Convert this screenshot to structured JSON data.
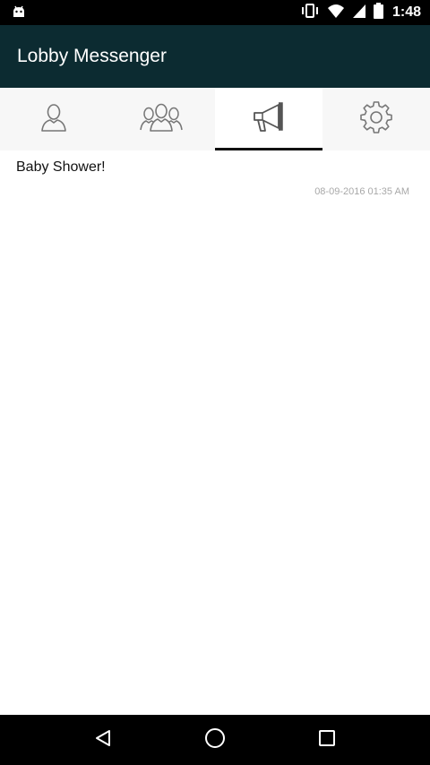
{
  "status_bar": {
    "time": "1:48",
    "icons": [
      "android-debug-icon",
      "vibrate-icon",
      "wifi-icon",
      "signal-icon",
      "battery-icon"
    ]
  },
  "app_bar": {
    "title": "Lobby Messenger",
    "background": "#0c2b31"
  },
  "tabs": [
    {
      "icon": "person-icon",
      "active": false
    },
    {
      "icon": "group-icon",
      "active": false
    },
    {
      "icon": "megaphone-icon",
      "active": true
    },
    {
      "icon": "gear-icon",
      "active": false
    }
  ],
  "announcements": [
    {
      "title": "Baby Shower!",
      "timestamp": "08-09-2016 01:35 AM"
    }
  ],
  "nav_bar": {
    "buttons": [
      "back-icon",
      "home-icon",
      "recents-icon"
    ]
  }
}
